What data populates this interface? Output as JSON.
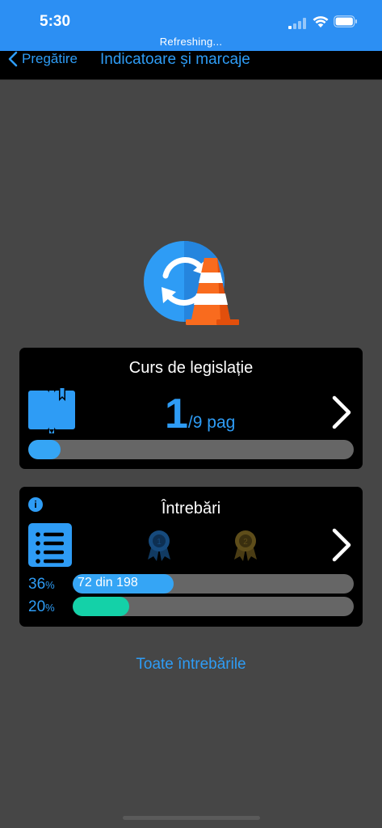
{
  "status": {
    "time": "5:30",
    "refresh_text": "Refreshing..."
  },
  "nav": {
    "back_label": "Pregătire",
    "title": "Indicatoare și marcaje"
  },
  "course_card": {
    "title": "Curs de legislație",
    "page_current": "1",
    "page_total": "/9 pag",
    "progress": 0.1
  },
  "questions_card": {
    "title": "Întrebări",
    "info_glyph": "i",
    "medals": [
      "medal-1-icon",
      "medal-2-icon"
    ],
    "bars": [
      {
        "percent": "36",
        "unit": "%",
        "label": "72 din 198",
        "fraction": 0.36,
        "color": "#35a5f5"
      },
      {
        "percent": "20",
        "unit": "%",
        "label": "",
        "fraction": 0.2,
        "color": "#14d1a8"
      }
    ]
  },
  "footer": {
    "all_questions_link": "Toate întrebările"
  },
  "colors": {
    "accent": "#2e9cf5",
    "status_bar": "#2c8ff3",
    "background": "#464646",
    "card": "#000000",
    "track": "#666666",
    "teal": "#14d1a8",
    "cone_orange": "#f96b1e"
  }
}
